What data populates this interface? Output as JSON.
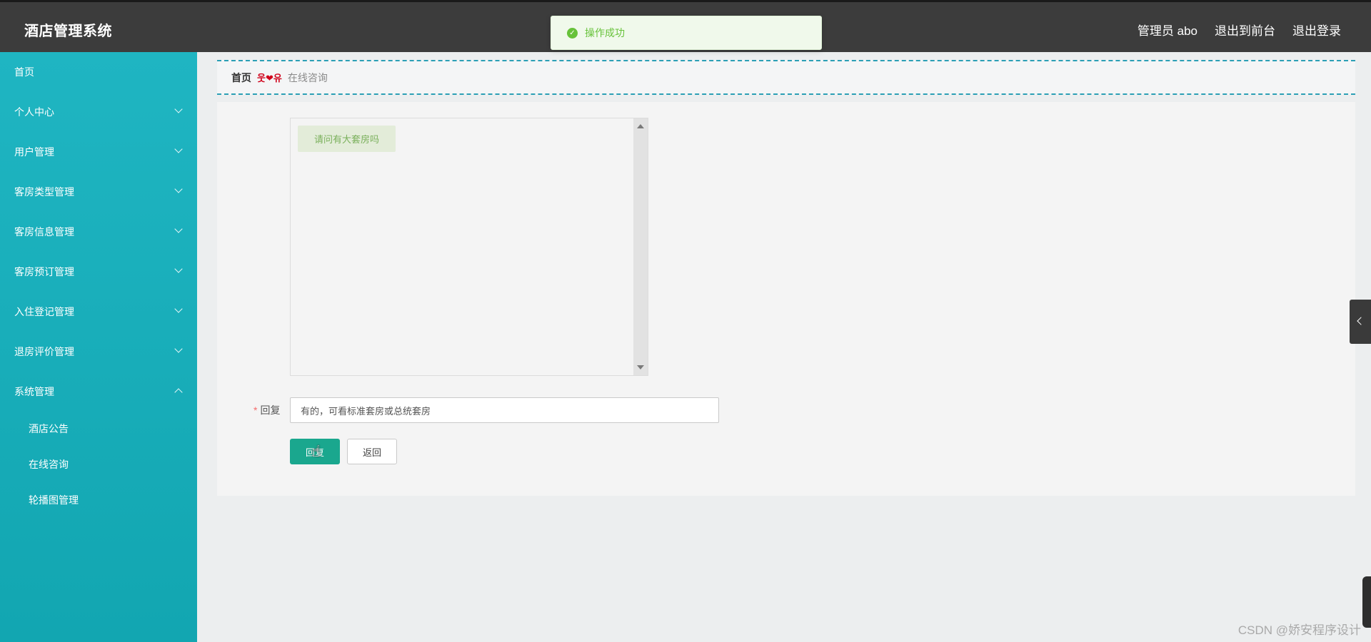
{
  "header": {
    "app_title": "酒店管理系统",
    "user_label": "管理员 abo",
    "front_link": "退出到前台",
    "logout_link": "退出登录"
  },
  "toast": {
    "message": "操作成功",
    "icon": "check-circle-icon",
    "color": "#67c23a"
  },
  "sidebar": {
    "items": [
      {
        "label": "首页",
        "expandable": false
      },
      {
        "label": "个人中心",
        "expandable": true
      },
      {
        "label": "用户管理",
        "expandable": true
      },
      {
        "label": "客房类型管理",
        "expandable": true
      },
      {
        "label": "客房信息管理",
        "expandable": true
      },
      {
        "label": "客房预订管理",
        "expandable": true
      },
      {
        "label": "入住登记管理",
        "expandable": true
      },
      {
        "label": "退房评价管理",
        "expandable": true
      },
      {
        "label": "系统管理",
        "expandable": true,
        "expanded": true
      }
    ],
    "subitems": [
      {
        "label": "酒店公告"
      },
      {
        "label": "在线咨询"
      },
      {
        "label": "轮播图管理"
      }
    ],
    "color": "#1fb5c2"
  },
  "breadcrumb": {
    "home": "首页",
    "separator": "웃❤유",
    "current": "在线咨询"
  },
  "chat": {
    "messages": [
      {
        "text": "请问有大套房吗"
      }
    ]
  },
  "form": {
    "reply_label": "回复",
    "required_mark": "*",
    "reply_value": "有的，可看标准套房或总统套房",
    "submit_label": "回复",
    "back_label": "返回",
    "accent": "#1aa78e"
  },
  "watermark": "CSDN @娇安程序设计"
}
